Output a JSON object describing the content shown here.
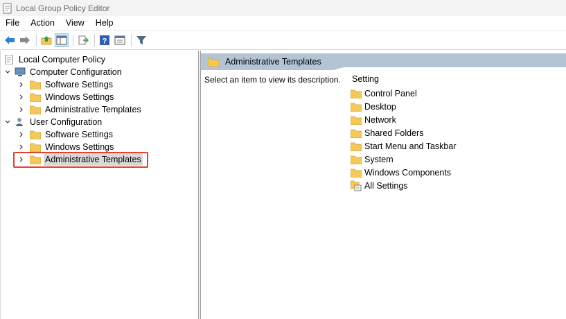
{
  "window": {
    "title": "Local Group Policy Editor"
  },
  "menu": {
    "items": [
      "File",
      "Action",
      "View",
      "Help"
    ]
  },
  "toolbar": {
    "buttons": [
      "back-icon",
      "forward-icon",
      "up-folder-icon",
      "show-hide-tree-icon",
      "export-list-icon",
      "help-icon",
      "properties-icon",
      "filter-icon"
    ]
  },
  "tree": {
    "root": "Local Computer Policy",
    "computer_config": "Computer Configuration",
    "cc_software": "Software Settings",
    "cc_windows": "Windows Settings",
    "cc_admin": "Administrative Templates",
    "user_config": "User Configuration",
    "uc_software": "Software Settings",
    "uc_windows": "Windows Settings",
    "uc_admin": "Administrative Templates"
  },
  "right": {
    "header": "Administrative Templates",
    "description": "Select an item to view its description.",
    "column_header": "Setting",
    "items": [
      "Control Panel",
      "Desktop",
      "Network",
      "Shared Folders",
      "Start Menu and Taskbar",
      "System",
      "Windows Components",
      "All Settings"
    ]
  },
  "colors": {
    "header_band": "#b3c4d6",
    "highlight": "#e0442e",
    "folder": "#f5c85a"
  }
}
